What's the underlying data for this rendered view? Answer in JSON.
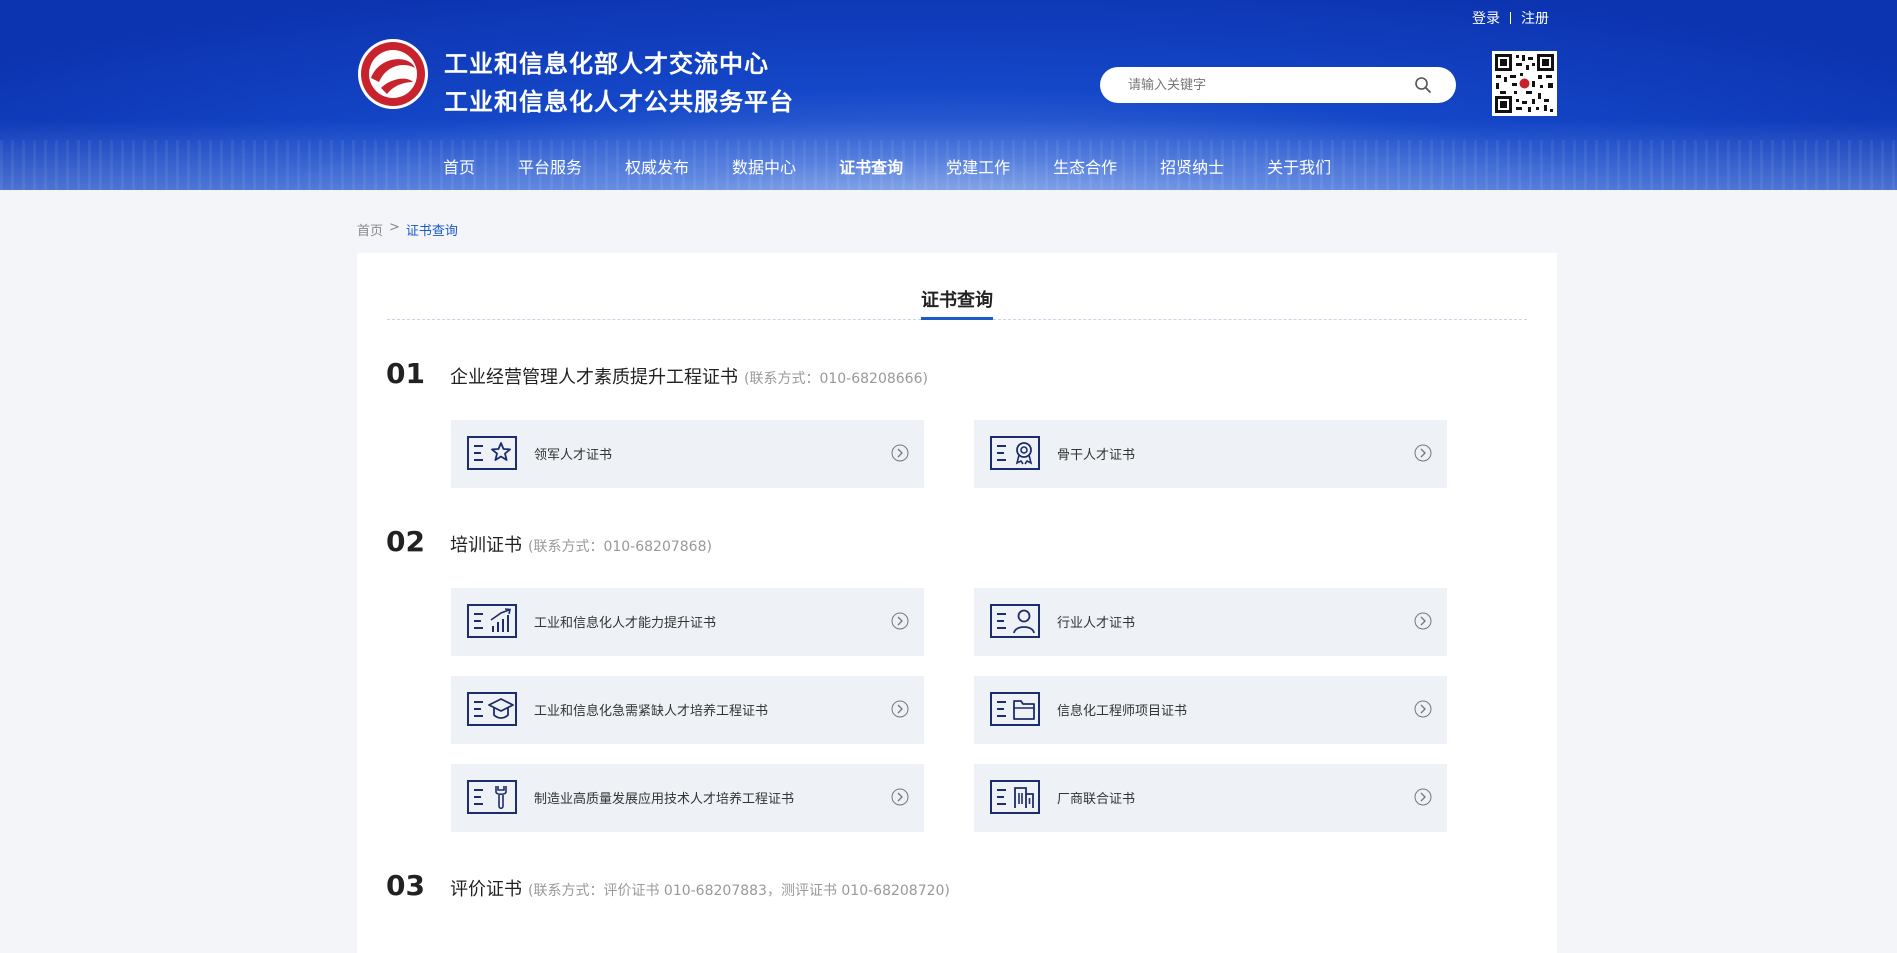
{
  "header": {
    "login": "登录",
    "register": "注册",
    "title_line1": "工业和信息化部人才交流中心",
    "title_line2": "工业和信息化人才公共服务平台",
    "search_placeholder": "请输入关键字",
    "nav": [
      "首页",
      "平台服务",
      "权威发布",
      "数据中心",
      "证书查询",
      "党建工作",
      "生态合作",
      "招贤纳士",
      "关于我们"
    ],
    "nav_active": "证书查询"
  },
  "breadcrumb": {
    "home": "首页",
    "separator": ">",
    "current": "证书查询"
  },
  "page_title": "证书查询",
  "sections": [
    {
      "number": "01",
      "name": "企业经营管理人才素质提升工程证书",
      "contact": "(联系方式：010-68208666)",
      "certs": [
        {
          "label": "领军人才证书",
          "icon": "star-icon"
        },
        {
          "label": "骨干人才证书",
          "icon": "award-ribbon-icon"
        }
      ]
    },
    {
      "number": "02",
      "name": "培训证书",
      "contact": "(联系方式：010-68207868)",
      "certs": [
        {
          "label": "工业和信息化人才能力提升证书",
          "icon": "growth-chart-icon"
        },
        {
          "label": "行业人才证书",
          "icon": "person-icon"
        },
        {
          "label": "工业和信息化急需紧缺人才培养工程证书",
          "icon": "graduation-cap-icon"
        },
        {
          "label": "信息化工程师项目证书",
          "icon": "folder-icon"
        },
        {
          "label": "制造业高质量发展应用技术人才培养工程证书",
          "icon": "wrench-icon"
        },
        {
          "label": "厂商联合证书",
          "icon": "building-icon"
        }
      ]
    },
    {
      "number": "03",
      "name": "评价证书",
      "contact": "(联系方式：评价证书 010-68207883，测评证书 010-68208720)",
      "certs": []
    }
  ],
  "colors": {
    "accent": "#1b5ac8",
    "icon": "#1c2d6b",
    "header": "#1447c8"
  }
}
